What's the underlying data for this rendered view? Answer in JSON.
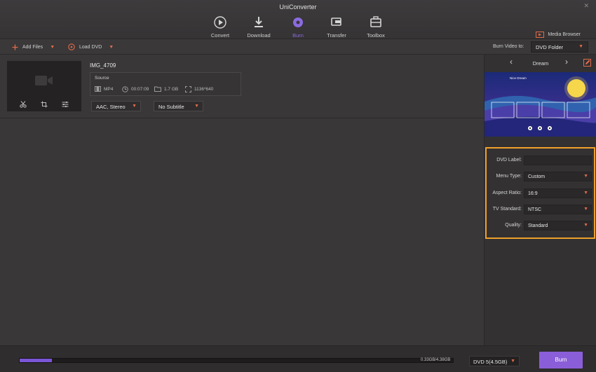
{
  "app": {
    "title": "UniConverter"
  },
  "nav": {
    "tabs": [
      {
        "label": "Convert",
        "icon": "convert-icon"
      },
      {
        "label": "Download",
        "icon": "download-icon"
      },
      {
        "label": "Burn",
        "icon": "burn-icon",
        "active": true
      },
      {
        "label": "Transfer",
        "icon": "transfer-icon"
      },
      {
        "label": "Toolbox",
        "icon": "toolbox-icon"
      }
    ],
    "media_browser": "Media Browser"
  },
  "toolbar": {
    "add_files": "Add Files",
    "load_dvd": "Load DVD",
    "burn_to_label": "Burn Video to:",
    "burn_to_value": "DVD Folder"
  },
  "file": {
    "name": "IMG_4709",
    "source_label": "Source",
    "format": "MP4",
    "duration": "00:07:09",
    "size": "1.7 GB",
    "resolution": "1136*640",
    "audio": "AAC, Stereo",
    "subtitle": "No Subtitle"
  },
  "template": {
    "name": "Dream",
    "preview_title": "Nice Dream"
  },
  "dvd_settings": {
    "dvd_label": {
      "label": "DVD Label:",
      "value": ""
    },
    "menu_type": {
      "label": "Menu Type:",
      "value": "Custom"
    },
    "aspect_ratio": {
      "label": "Aspect Ratio:",
      "value": "16:9"
    },
    "tv_standard": {
      "label": "TV Standard:",
      "value": "NTSC"
    },
    "quality": {
      "label": "Quality:",
      "value": "Standard"
    }
  },
  "bottom": {
    "progress_fraction": 0.075,
    "progress_text": "0.33GB/4.38GB",
    "disc": "DVD 5(4.5GB)",
    "burn": "Burn"
  },
  "colors": {
    "accent": "#8b5ed9",
    "highlight_border": "#f0a02a",
    "caret": "#e06a4a"
  }
}
